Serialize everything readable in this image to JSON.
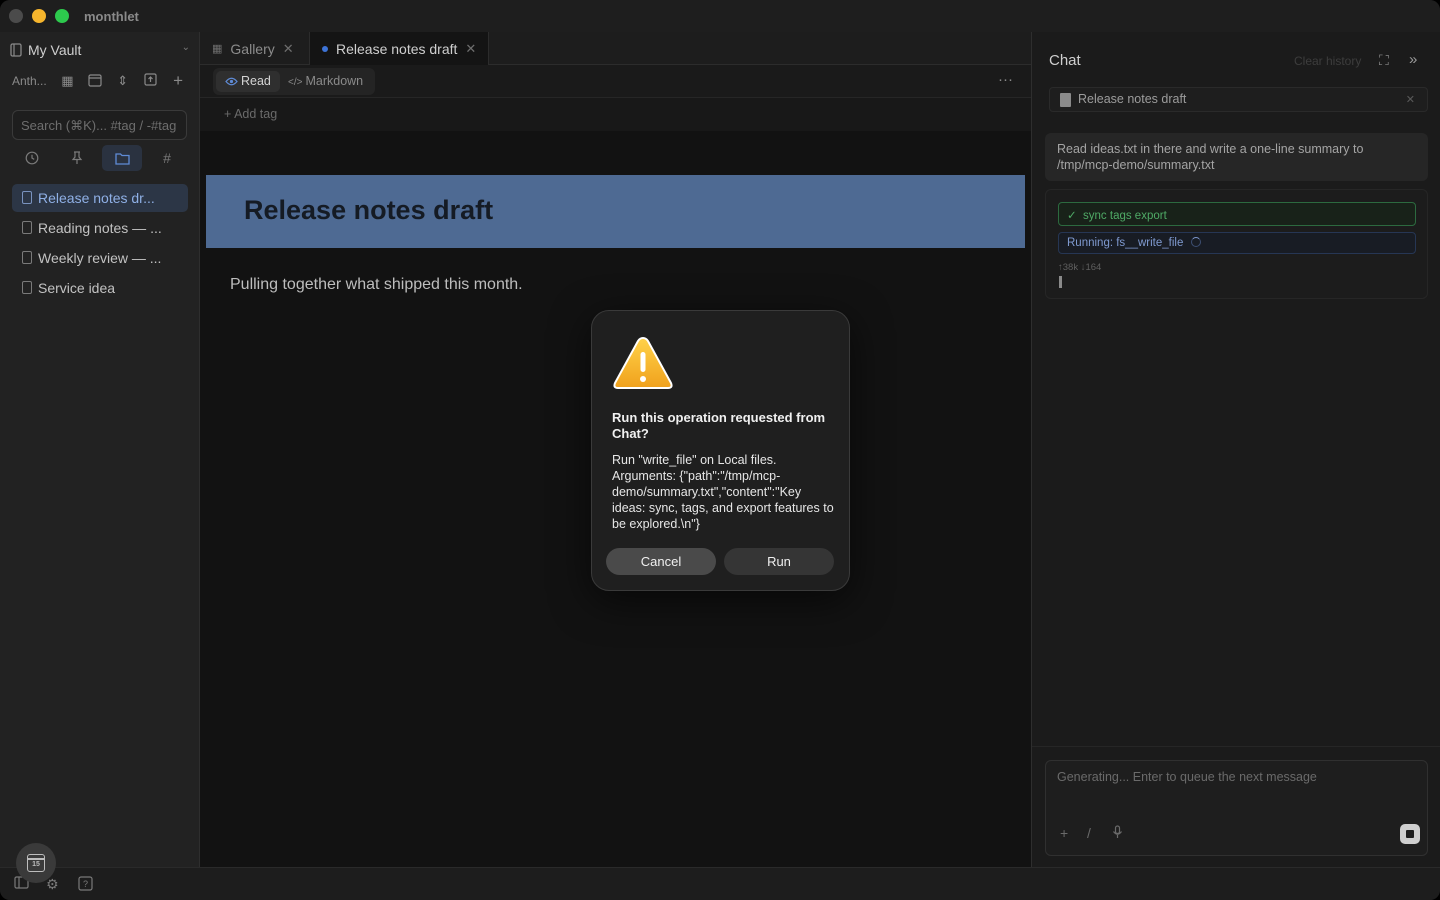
{
  "app": {
    "title": "monthlet"
  },
  "sidebar": {
    "vault_name": "My Vault",
    "toolbar_label": "Anth...",
    "search_placeholder": "Search (⌘K)... #tag / -#tag",
    "filters": [
      "recent-icon",
      "pin-icon",
      "folder-icon",
      "hashtag-icon"
    ],
    "notes": [
      {
        "label": "Release notes dr...",
        "active": true
      },
      {
        "label": "Reading notes — ...",
        "active": false
      },
      {
        "label": "Weekly review — ...",
        "active": false
      },
      {
        "label": "Service idea",
        "active": false
      }
    ]
  },
  "tabs": [
    {
      "label": "Gallery",
      "active": false
    },
    {
      "label": "Release notes draft",
      "active": true
    }
  ],
  "viewbar": {
    "read_label": "Read",
    "markdown_label": "Markdown"
  },
  "editor": {
    "add_tag": "+ Add tag",
    "title": "Release notes draft",
    "body": "Pulling together what shipped this month."
  },
  "chat": {
    "title": "Chat",
    "clear_label": "Clear history",
    "context_file": "Release notes draft",
    "user_message": "Read ideas.txt in there and write a one-line summary to /tmp/mcp-demo/summary.txt",
    "step_done": "sync tags export",
    "step_running": "Running: fs__write_file",
    "tokens": "↑38k ↓164",
    "composer_placeholder": "Generating... Enter to queue the next message"
  },
  "dialog": {
    "title": "Run this operation requested from Chat?",
    "message": "Run \"write_file\" on Local files. Arguments: {\"path\":\"/tmp/mcp-demo/summary.txt\",\"content\":\"Key ideas: sync, tags, and export features to be explored.\\n\"}",
    "cancel_label": "Cancel",
    "run_label": "Run"
  },
  "calendar_day": "15",
  "colors": {
    "accent": "#3d73d6",
    "banner": "#4e6a93",
    "success": "#4faa66"
  }
}
